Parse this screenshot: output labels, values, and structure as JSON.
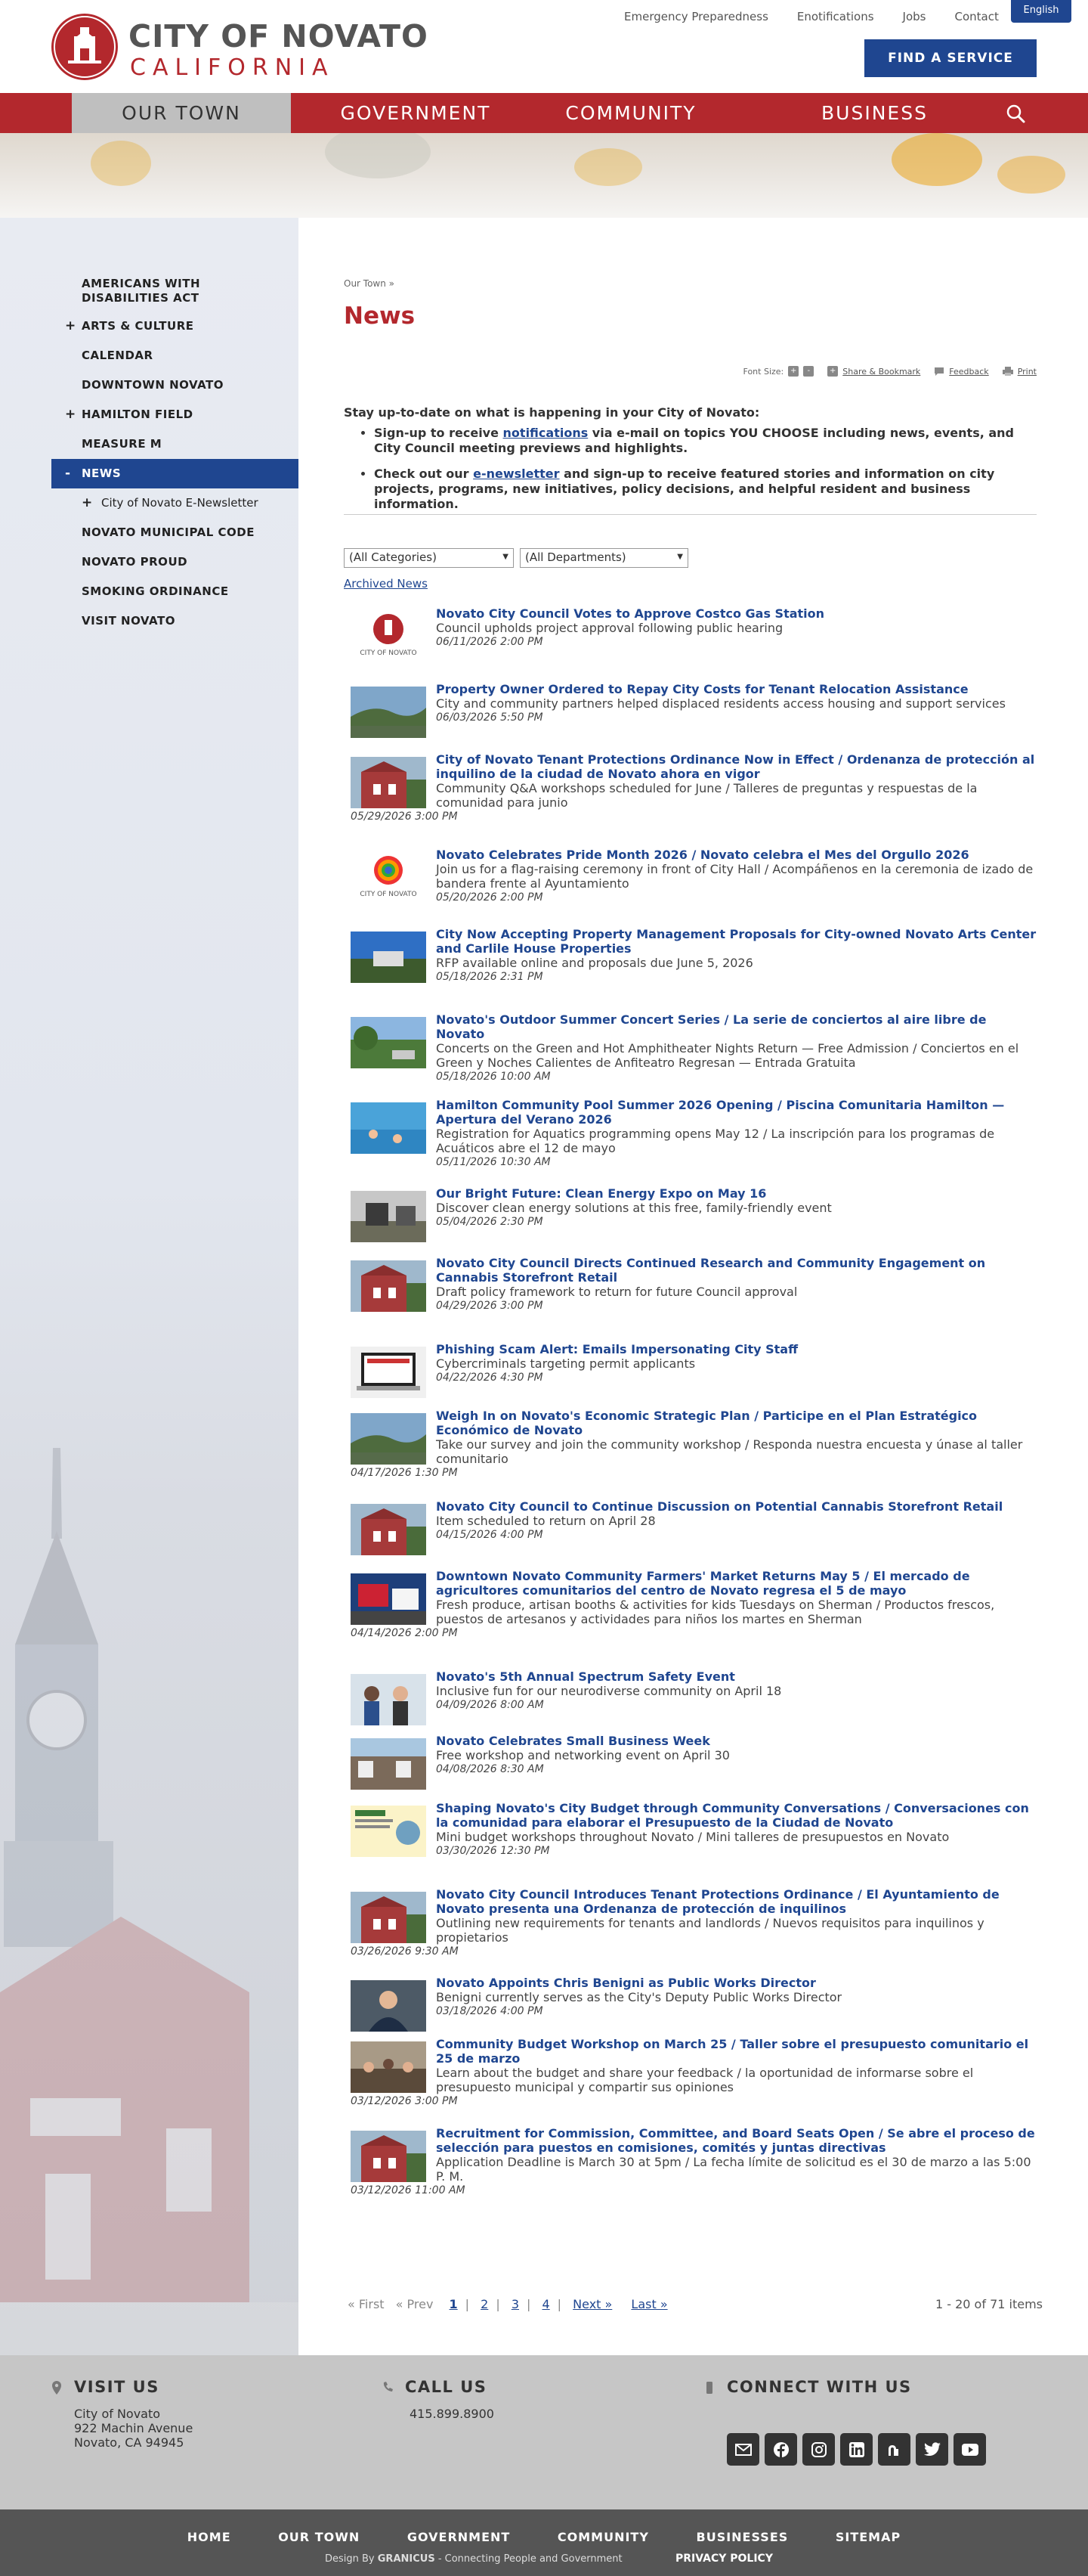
{
  "header": {
    "logo_line1": "CITY OF NOVATO",
    "logo_line2": "CALIFORNIA",
    "utility_links": [
      "Emergency Preparedness",
      "Enotifications",
      "Jobs",
      "Contact"
    ],
    "language_label": "English",
    "find_service_label": "FIND A SERVICE"
  },
  "main_nav": {
    "tabs": [
      "OUR TOWN",
      "GOVERNMENT",
      "COMMUNITY",
      "BUSINESS"
    ],
    "active_tab": "OUR TOWN"
  },
  "sidebar": {
    "items": [
      {
        "label": "AMERICANS WITH DISABILITIES ACT",
        "expander": ""
      },
      {
        "label": "ARTS & CULTURE",
        "expander": "+"
      },
      {
        "label": "CALENDAR",
        "expander": ""
      },
      {
        "label": "DOWNTOWN NOVATO",
        "expander": ""
      },
      {
        "label": "HAMILTON FIELD",
        "expander": "+"
      },
      {
        "label": "MEASURE M",
        "expander": ""
      },
      {
        "label": "NEWS",
        "expander": "-"
      },
      {
        "label": "City of Novato E-Newsletter",
        "expander": "+"
      },
      {
        "label": "NOVATO MUNICIPAL CODE",
        "expander": ""
      },
      {
        "label": "NOVATO PROUD",
        "expander": ""
      },
      {
        "label": "SMOKING ORDINANCE",
        "expander": ""
      },
      {
        "label": "VISIT NOVATO",
        "expander": ""
      }
    ]
  },
  "page": {
    "breadcrumb": "Our Town »",
    "title": "News",
    "font_size_label": "Font Size:",
    "font_plus": "+",
    "font_minus": "-",
    "share_label": "Share & Bookmark",
    "feedback_label": "Feedback",
    "print_label": "Print",
    "intro_heading": "Stay up-to-date on what is happening in your City of Novato:",
    "bullet1_pre": "Sign-up to receive ",
    "bullet1_link": "notifications",
    "bullet1_post": " via e-mail on topics YOU CHOOSE including news, events, and City Council meeting previews and highlights.",
    "bullet2_pre": "Check out our ",
    "bullet2_link": "e-newsletter",
    "bullet2_post": " and sign-up to receive featured stories and information on city projects, programs, new initiatives, policy decisions, and helpful resident and business information.",
    "filter_categories": "(All Categories)",
    "filter_departments": "(All Departments)",
    "archived_label": "Archived News"
  },
  "news": [
    {
      "title": "Novato City Council Votes to Approve Costco Gas Station",
      "subtitle": "Council upholds project approval following public hearing",
      "date": "06/11/2026 2:00 PM",
      "thumb": "logo"
    },
    {
      "title": "Property Owner Ordered to Repay City Costs for Tenant Relocation Assistance",
      "subtitle": "City and community partners helped displaced residents access housing and support services",
      "date": "06/03/2026 5:50 PM",
      "thumb": "landscape"
    },
    {
      "title": "City of Novato Tenant Protections Ordinance Now in Effect / Ordenanza de protección al inquilino de la ciudad de Novato ahora en vigor",
      "subtitle": "Community Q&A workshops scheduled for June / Talleres de preguntas y respuestas de la comunidad para junio",
      "date": "05/29/2026 3:00 PM",
      "thumb": "cityhall"
    },
    {
      "title": "Novato Celebrates Pride Month 2026 / Novato celebra el Mes del Orgullo 2026",
      "subtitle": "Join us for a flag-raising ceremony in front of City Hall / Acompáñenos en la ceremonia de izado de bandera frente al Ayuntamiento",
      "date": "05/20/2026 2:00 PM",
      "thumb": "pride"
    },
    {
      "title": "City Now Accepting Property Management Proposals for City-owned Novato Arts Center and Carlile House Properties",
      "subtitle": "RFP available online and proposals due June 5, 2026",
      "date": "05/18/2026 2:31 PM",
      "thumb": "building"
    },
    {
      "title": "Novato's Outdoor Summer Concert Series / La serie de conciertos al aire libre de Novato",
      "subtitle": "Concerts on the Green and Hot Amphitheater Nights Return — Free Admission / Conciertos en el Green y Noches Calientes de Anfiteatro Regresan — Entrada Gratuita",
      "date": "05/18/2026 10:00 AM",
      "thumb": "park"
    },
    {
      "title": "Hamilton Community Pool Summer 2026 Opening / Piscina Comunitaria Hamilton — Apertura del Verano 2026",
      "subtitle": "Registration for Aquatics programming opens May 12 / La inscripción para los programas de Acuáticos abre el 12 de mayo",
      "date": "05/11/2026 10:30 AM",
      "thumb": "pool"
    },
    {
      "title": "Our Bright Future: Clean Energy Expo on May 16",
      "subtitle": "Discover clean energy solutions at this free, family-friendly event",
      "date": "05/04/2026 2:30 PM",
      "thumb": "expo"
    },
    {
      "title": "Novato City Council Directs Continued Research and Community Engagement on Cannabis Storefront Retail",
      "subtitle": "Draft policy framework to return for future Council approval",
      "date": "04/29/2026 3:00 PM",
      "thumb": "cityhall"
    },
    {
      "title": "Phishing Scam Alert: Emails Impersonating City Staff",
      "subtitle": "Cybercriminals targeting permit applicants",
      "date": "04/22/2026 4:30 PM",
      "thumb": "laptop"
    },
    {
      "title": "Weigh In on Novato's Economic Strategic Plan / Participe en el Plan Estratégico Económico de Novato",
      "subtitle": "Take our survey and join the community workshop / Responda nuestra encuesta y únase al taller comunitario",
      "date": "04/17/2026 1:30 PM",
      "thumb": "landscape"
    },
    {
      "title": "Novato City Council to Continue Discussion on Potential Cannabis Storefront Retail",
      "subtitle": "Item scheduled to return on April 28",
      "date": "04/15/2026 4:00 PM",
      "thumb": "cityhall"
    },
    {
      "title": "Downtown Novato Community Farmers' Market Returns May 5 / El mercado de agricultores comunitarios del centro de Novato regresa el 5 de mayo",
      "subtitle": "Fresh produce, artisan booths & activities for kids Tuesdays on Sherman / Productos frescos, puestos de artesanos y actividades para niños los martes en Sherman",
      "date": "04/14/2026 2:00 PM",
      "thumb": "market"
    },
    {
      "title": "Novato's 5th Annual Spectrum Safety Event",
      "subtitle": "Inclusive fun for our neurodiverse community on April 18",
      "date": "04/09/2026 8:00 AM",
      "thumb": "people"
    },
    {
      "title": "Novato Celebrates Small Business Week",
      "subtitle": "Free workshop and networking event on April 30",
      "date": "04/08/2026 8:30 AM",
      "thumb": "street"
    },
    {
      "title": "Shaping Novato's City Budget through Community Conversations / Conversaciones con la comunidad para elaborar el Presupuesto de la Ciudad de Novato",
      "subtitle": "Mini budget workshops throughout Novato / Mini talleres de presupuestos en Novato",
      "date": "03/30/2026 12:30 PM",
      "thumb": "flyer"
    },
    {
      "title": "Novato City Council Introduces Tenant Protections Ordinance / El Ayuntamiento de Novato presenta una Ordenanza de protección de inquilinos",
      "subtitle": "Outlining new requirements for tenants and landlords / Nuevos requisitos para inquilinos y propietarios",
      "date": "03/26/2026 9:30 AM",
      "thumb": "cityhall"
    },
    {
      "title": "Novato Appoints Chris Benigni as Public Works Director",
      "subtitle": "Benigni currently serves as the City's Deputy Public Works Director",
      "date": "03/18/2026 4:00 PM",
      "thumb": "portrait"
    },
    {
      "title": "Community Budget Workshop on March 25 / Taller sobre el presupuesto comunitario el 25 de marzo",
      "subtitle": "Learn about the budget and share your feedback / la oportunidad de informarse sobre el presupuesto municipal y compartir sus opiniones",
      "date": "03/12/2026 3:00 PM",
      "thumb": "meeting"
    },
    {
      "title": "Recruitment for Commission, Committee, and Board Seats Open / Se abre el proceso de selección para puestos en comisiones, comités y juntas directivas",
      "subtitle": "Application Deadline is March 30 at 5pm / La fecha límite de solicitud es el 30 de marzo a las 5:00 P. M.",
      "date": "03/12/2026 11:00 AM",
      "thumb": "cityhall"
    }
  ],
  "pager": {
    "first": "« First",
    "prev": "« Prev",
    "pages": [
      "1",
      "2",
      "3",
      "4"
    ],
    "current": "1",
    "next": "Next »",
    "last": "Last »",
    "count": "1 - 20 of 71 items"
  },
  "footer": {
    "visit_heading": "VISIT US",
    "address1": "City of Novato",
    "address2": "922 Machin Avenue",
    "address3": "Novato, CA 94945",
    "call_heading": "CALL US",
    "phone": "415.899.8900",
    "connect_heading": "CONNECT WITH US",
    "social": [
      "email-icon",
      "facebook-icon",
      "instagram-icon",
      "linkedin-icon",
      "nextdoor-icon",
      "twitter-icon",
      "youtube-icon"
    ]
  },
  "bottom_bar": {
    "links": [
      "HOME",
      "OUR TOWN",
      "GOVERNMENT",
      "COMMUNITY",
      "BUSINESSES",
      "SITEMAP"
    ],
    "credit_pre": "Design By ",
    "credit_brand": "GRANICUS",
    "credit_post": " - Connecting People and Government",
    "privacy": "PRIVACY POLICY"
  },
  "colors": {
    "brand_red": "#b3282d",
    "brand_blue": "#1f4690",
    "nav_active": "#bfbfbf"
  }
}
